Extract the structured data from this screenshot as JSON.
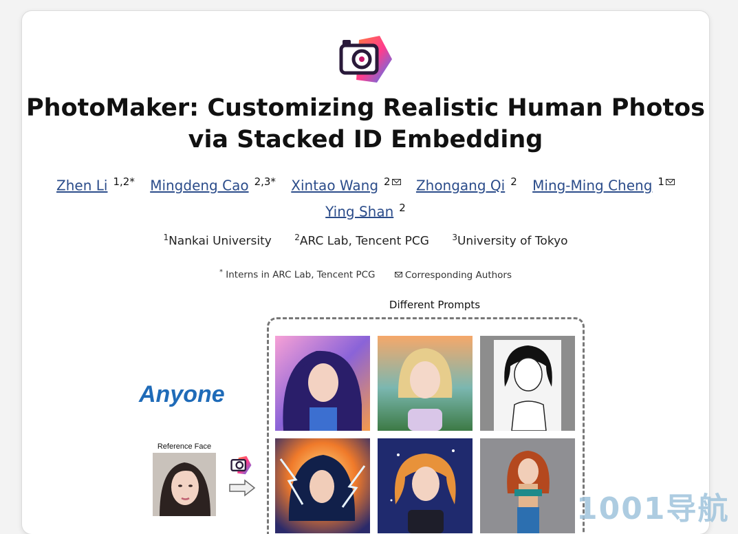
{
  "header": {
    "title_line1": "PhotoMaker: Customizing Realistic Human Photos",
    "title_line2": "via Stacked ID Embedding"
  },
  "authors": [
    {
      "name": "Zhen Li",
      "sup": "1,2*",
      "mail": false
    },
    {
      "name": "Mingdeng Cao",
      "sup": "2,3*",
      "mail": false
    },
    {
      "name": "Xintao Wang",
      "sup": "2",
      "mail": true
    },
    {
      "name": "Zhongang Qi",
      "sup": "2",
      "mail": false
    },
    {
      "name": "Ming-Ming Cheng",
      "sup": "1",
      "mail": true
    },
    {
      "name": "Ying Shan",
      "sup": "2",
      "mail": false
    }
  ],
  "affiliations": [
    {
      "num": "1",
      "name": "Nankai University"
    },
    {
      "num": "2",
      "name": "ARC Lab, Tencent PCG"
    },
    {
      "num": "3",
      "name": "University of Tokyo"
    }
  ],
  "notes": {
    "star": "*",
    "interns": "Interns in ARC Lab, Tencent PCG",
    "corresponding": "Corresponding Authors"
  },
  "teaser": {
    "prompts_label": "Different Prompts",
    "anyone": "Anyone",
    "reference_label": "Reference Face"
  },
  "watermark": "1001导航",
  "colors": {
    "link": "#2b4c8a",
    "anyone": "#1f6bb8",
    "watermark": "#9fc4dc"
  }
}
